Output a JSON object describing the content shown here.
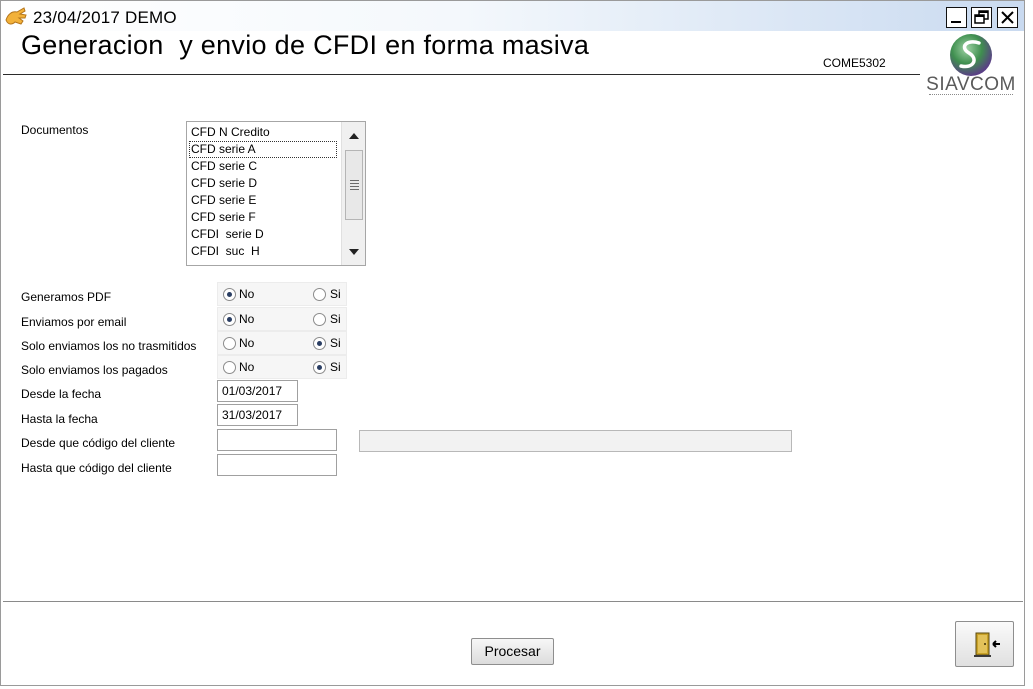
{
  "window": {
    "title": "23/04/2017  DEMO",
    "buttons": {
      "minimize": "minimize-icon",
      "restore": "restore-icon",
      "close": "close-icon"
    }
  },
  "header": {
    "title": "Generacion  y envio de CFDI en forma masiva",
    "form_code": "COME5302",
    "logo_text": "SIAVCOM"
  },
  "documents": {
    "label": "Documentos",
    "items": [
      "CFD N Credito",
      "CFD serie A",
      "CFD serie C",
      "CFD serie D",
      "CFD serie E",
      "CFD serie F",
      "CFDI  serie D",
      "CFDI  suc  H"
    ],
    "selected": "CFD serie A"
  },
  "options": [
    {
      "label": "Generamos PDF",
      "no_label": "No",
      "si_label": "Si",
      "value": "No"
    },
    {
      "label": "Enviamos por email",
      "no_label": "No",
      "si_label": "Si",
      "value": "No"
    },
    {
      "label": "Solo enviamos los no trasmitidos",
      "no_label": "No",
      "si_label": "Si",
      "value": "Si"
    },
    {
      "label": "Solo enviamos los pagados",
      "no_label": "No",
      "si_label": "Si",
      "value": "Si"
    }
  ],
  "dates": {
    "from_label": "Desde la fecha",
    "from_value": "01/03/2017",
    "to_label": "Hasta la fecha",
    "to_value": "31/03/2017"
  },
  "clients": {
    "from_label": "Desde que código del cliente",
    "from_value": "",
    "from_name": "",
    "to_label": "Hasta que código del cliente",
    "to_value": ""
  },
  "actions": {
    "process_label": "Procesar",
    "exit_icon": "exit-door-icon"
  },
  "colors": {
    "titlebar_gradient_end": "#c9daf0",
    "radio_dot": "#2a3e63",
    "logo_green": "#3f8f4f",
    "logo_purple": "#5a3f86"
  }
}
